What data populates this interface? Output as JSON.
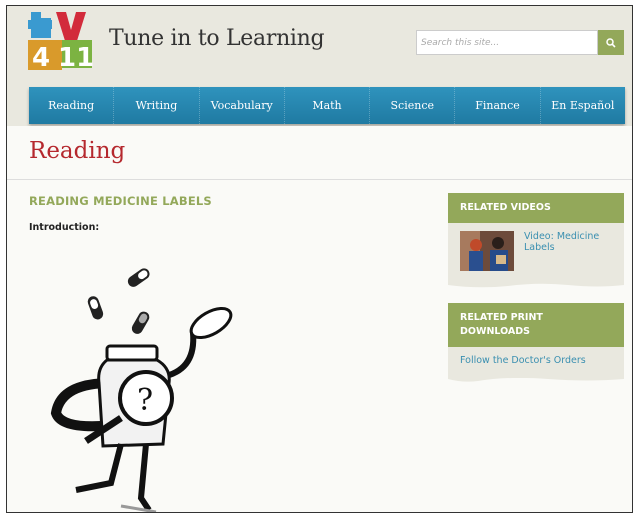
{
  "header": {
    "logo_text": "TV411",
    "site_title": "Tune in to Learning",
    "search": {
      "placeholder": "Search this site...",
      "value": "",
      "button_icon": "search-icon"
    }
  },
  "nav": {
    "items": [
      {
        "label": "Reading"
      },
      {
        "label": "Writing"
      },
      {
        "label": "Vocabulary"
      },
      {
        "label": "Math"
      },
      {
        "label": "Science"
      },
      {
        "label": "Finance"
      },
      {
        "label": "En Español"
      }
    ]
  },
  "page": {
    "title": "Reading",
    "article_title": "READING MEDICINE LABELS",
    "intro_label": "Introduction:",
    "illustration": "medicine-bottle-character-illustration"
  },
  "sidebar": {
    "related_videos": {
      "heading": "RELATED VIDEOS",
      "items": [
        {
          "label": "Video: Medicine Labels"
        }
      ]
    },
    "related_downloads": {
      "heading": "RELATED PRINT DOWNLOADS",
      "items": [
        {
          "label": "Follow the Doctor's Orders"
        }
      ]
    }
  },
  "colors": {
    "accent_green": "#93a85a",
    "nav_blue": "#2387b1",
    "title_red": "#b5282e",
    "link_blue": "#3a8fb0"
  }
}
